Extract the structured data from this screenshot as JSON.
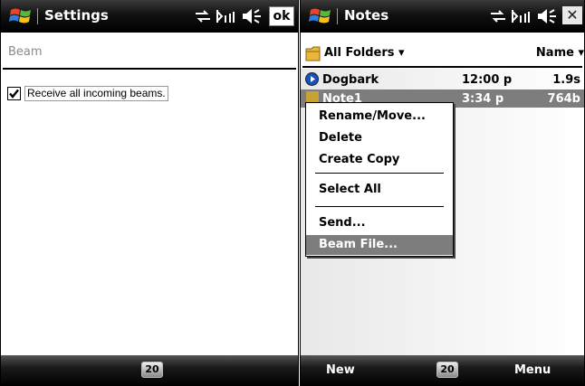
{
  "left": {
    "title": "Settings",
    "ok": "ok",
    "section": "Beam",
    "checkbox_label": "Receive all incoming beams.",
    "checkbox_checked": true,
    "keyboard": "20"
  },
  "right": {
    "title": "Notes",
    "folder": "All Folders",
    "sort": "Name",
    "rows": [
      {
        "name": "Dogbark",
        "time": "12:00 p",
        "size": "1.9s"
      },
      {
        "name": "Note1",
        "time": "3:34 p",
        "size": "764b"
      }
    ],
    "menu": [
      "Rename/Move...",
      "Delete",
      "Create Copy",
      "Select All",
      "Send...",
      "Beam File..."
    ],
    "softkeys": {
      "left": "New",
      "keyboard": "20",
      "right": "Menu"
    }
  },
  "colors": {
    "titlebar": "#000000",
    "highlight": "#7d7d7d"
  },
  "icons": [
    "windows-start-icon",
    "connectivity-icon",
    "signal-icon",
    "volume-icon",
    "close-icon",
    "folder-icon",
    "media-icon",
    "note-icon",
    "keyboard-icon"
  ]
}
